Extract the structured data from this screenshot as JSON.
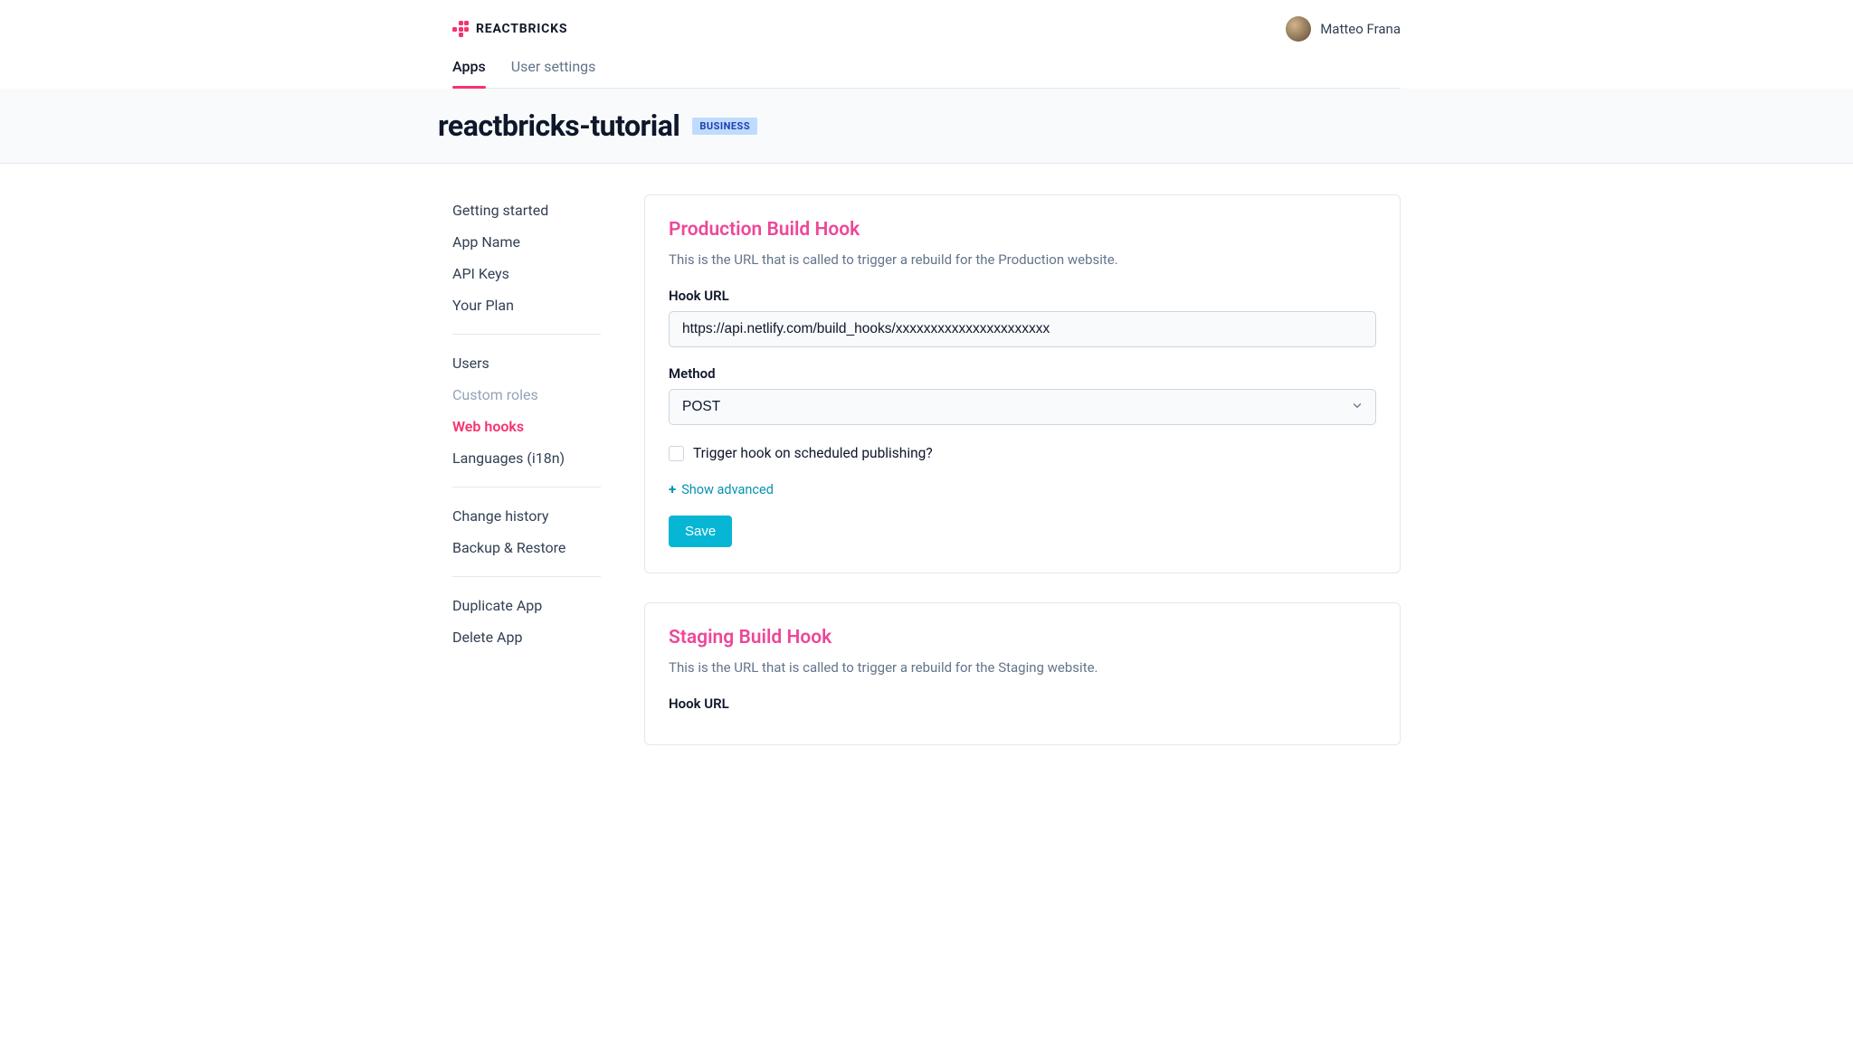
{
  "header": {
    "brand": "REACTBRICKS",
    "user_name": "Matteo Frana"
  },
  "tabs": {
    "apps": "Apps",
    "user_settings": "User settings"
  },
  "app": {
    "title": "reactbricks-tutorial",
    "plan_badge": "BUSINESS"
  },
  "sidebar": {
    "groups": [
      [
        "Getting started",
        "App Name",
        "API Keys",
        "Your Plan"
      ],
      [
        "Users",
        "Custom roles",
        "Web hooks",
        "Languages (i18n)"
      ],
      [
        "Change history",
        "Backup & Restore"
      ],
      [
        "Duplicate App",
        "Delete App"
      ]
    ],
    "active": "Web hooks",
    "muted": [
      "Custom roles"
    ]
  },
  "production_hook": {
    "title": "Production Build Hook",
    "description": "This is the URL that is called to trigger a rebuild for the Production website.",
    "hook_url_label": "Hook URL",
    "hook_url_value": "https://api.netlify.com/build_hooks/xxxxxxxxxxxxxxxxxxxxxx",
    "method_label": "Method",
    "method_value": "POST",
    "checkbox_label": "Trigger hook on scheduled publishing?",
    "show_advanced": "Show advanced",
    "save_label": "Save"
  },
  "staging_hook": {
    "title": "Staging Build Hook",
    "description": "This is the URL that is called to trigger a rebuild for the Staging website.",
    "hook_url_label": "Hook URL"
  }
}
